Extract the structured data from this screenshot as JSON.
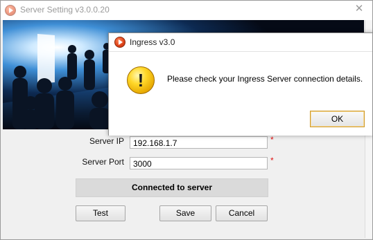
{
  "window": {
    "title": "Server Setting v3.0.0.20",
    "close_glyph": "✕",
    "icon": "ingress-play-icon"
  },
  "form": {
    "server_ip_label": "Server IP",
    "server_ip_value": "192.168.1.7",
    "server_port_label": "Server Port",
    "server_port_value": "3000",
    "required_marker": "*",
    "status_text": "Connected to server"
  },
  "buttons": {
    "test": "Test",
    "save": "Save",
    "cancel": "Cancel"
  },
  "dialog": {
    "title": "Ingress v3.0",
    "message": "Please check your Ingress Server connection details.",
    "ok_label": "OK",
    "icon": "warning-icon",
    "icon_glyph": "!"
  },
  "colors": {
    "required": "#e01010",
    "warning": "#ffd82a",
    "ok_focus_border": "#cf9a2a"
  }
}
